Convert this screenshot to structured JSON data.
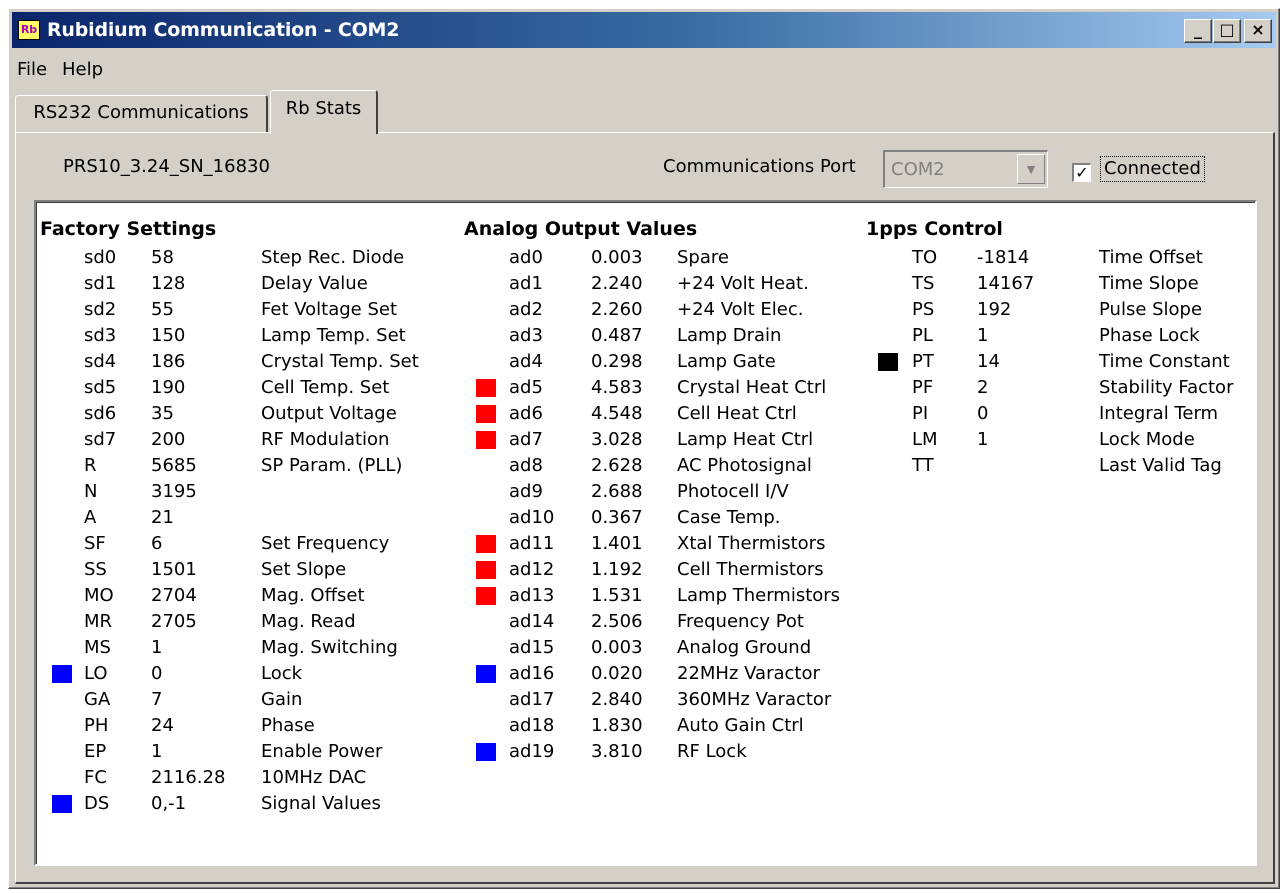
{
  "window": {
    "title": "Rubidium Communication - COM2",
    "icon_text": "Rb",
    "min_glyph": "_",
    "max_glyph": "□",
    "close_glyph": "×"
  },
  "menu": {
    "items": [
      "File",
      "Help"
    ]
  },
  "tabs": [
    {
      "label": "RS232 Communications",
      "active": false
    },
    {
      "label": "Rb Stats",
      "active": true
    }
  ],
  "header": {
    "firmware": "PRS10_3.24_SN_16830",
    "port_label": "Communications Port",
    "port_value": "COM2",
    "connected_label": "Connected",
    "connected_checked": true
  },
  "colors": {
    "red": "#ff0000",
    "blue": "#0000ff",
    "black": "#000000"
  },
  "factory": {
    "title": "Factory Settings",
    "rows": [
      {
        "key": "sd0",
        "value": "58",
        "desc": "Step Rec. Diode",
        "indicator": null
      },
      {
        "key": "sd1",
        "value": "128",
        "desc": "Delay Value",
        "indicator": null
      },
      {
        "key": "sd2",
        "value": "55",
        "desc": "Fet Voltage Set",
        "indicator": null
      },
      {
        "key": "sd3",
        "value": "150",
        "desc": "Lamp Temp. Set",
        "indicator": null
      },
      {
        "key": "sd4",
        "value": "186",
        "desc": "Crystal Temp. Set",
        "indicator": null
      },
      {
        "key": "sd5",
        "value": "190",
        "desc": "Cell Temp. Set",
        "indicator": null
      },
      {
        "key": "sd6",
        "value": "35",
        "desc": "Output Voltage",
        "indicator": null
      },
      {
        "key": "sd7",
        "value": "200",
        "desc": "RF Modulation",
        "indicator": null
      },
      {
        "key": "R",
        "value": "5685",
        "desc": "SP Param. (PLL)",
        "indicator": null
      },
      {
        "key": "N",
        "value": "3195",
        "desc": "",
        "indicator": null
      },
      {
        "key": "A",
        "value": "21",
        "desc": "",
        "indicator": null
      },
      {
        "key": "SF",
        "value": "6",
        "desc": "Set Frequency",
        "indicator": null
      },
      {
        "key": "SS",
        "value": "1501",
        "desc": "Set Slope",
        "indicator": null
      },
      {
        "key": "MO",
        "value": "2704",
        "desc": "Mag. Offset",
        "indicator": null
      },
      {
        "key": "MR",
        "value": "2705",
        "desc": "Mag. Read",
        "indicator": null
      },
      {
        "key": "MS",
        "value": "1",
        "desc": "Mag. Switching",
        "indicator": null
      },
      {
        "key": "LO",
        "value": "0",
        "desc": "Lock",
        "indicator": "blue"
      },
      {
        "key": "GA",
        "value": "7",
        "desc": "Gain",
        "indicator": null
      },
      {
        "key": "PH",
        "value": "24",
        "desc": "Phase",
        "indicator": null
      },
      {
        "key": "EP",
        "value": "1",
        "desc": "Enable Power",
        "indicator": null
      },
      {
        "key": "FC",
        "value": "2116.28",
        "desc": "10MHz DAC",
        "indicator": null
      },
      {
        "key": "DS",
        "value": "0,-1",
        "desc": "Signal Values",
        "indicator": "blue"
      }
    ]
  },
  "analog": {
    "title": "Analog Output Values",
    "rows": [
      {
        "key": "ad0",
        "value": "0.003",
        "desc": "Spare",
        "indicator": null
      },
      {
        "key": "ad1",
        "value": "2.240",
        "desc": "+24 Volt Heat.",
        "indicator": null
      },
      {
        "key": "ad2",
        "value": "2.260",
        "desc": "+24 Volt Elec.",
        "indicator": null
      },
      {
        "key": "ad3",
        "value": "0.487",
        "desc": "Lamp Drain",
        "indicator": null
      },
      {
        "key": "ad4",
        "value": "0.298",
        "desc": "Lamp Gate",
        "indicator": null
      },
      {
        "key": "ad5",
        "value": "4.583",
        "desc": "Crystal Heat Ctrl",
        "indicator": "red"
      },
      {
        "key": "ad6",
        "value": "4.548",
        "desc": "Cell Heat Ctrl",
        "indicator": "red"
      },
      {
        "key": "ad7",
        "value": "3.028",
        "desc": "Lamp Heat Ctrl",
        "indicator": "red"
      },
      {
        "key": "ad8",
        "value": "2.628",
        "desc": "AC Photosignal",
        "indicator": null
      },
      {
        "key": "ad9",
        "value": "2.688",
        "desc": "Photocell I/V",
        "indicator": null
      },
      {
        "key": "ad10",
        "value": "0.367",
        "desc": "Case Temp.",
        "indicator": null
      },
      {
        "key": "ad11",
        "value": "1.401",
        "desc": "Xtal Thermistors",
        "indicator": "red"
      },
      {
        "key": "ad12",
        "value": "1.192",
        "desc": "Cell Thermistors",
        "indicator": "red"
      },
      {
        "key": "ad13",
        "value": "1.531",
        "desc": "Lamp Thermistors",
        "indicator": "red"
      },
      {
        "key": "ad14",
        "value": "2.506",
        "desc": "Frequency Pot",
        "indicator": null
      },
      {
        "key": "ad15",
        "value": "0.003",
        "desc": "Analog Ground",
        "indicator": null
      },
      {
        "key": "ad16",
        "value": "0.020",
        "desc": "22MHz Varactor",
        "indicator": "blue"
      },
      {
        "key": "ad17",
        "value": "2.840",
        "desc": "360MHz Varactor",
        "indicator": null
      },
      {
        "key": "ad18",
        "value": "1.830",
        "desc": "Auto Gain Ctrl",
        "indicator": null
      },
      {
        "key": "ad19",
        "value": "3.810",
        "desc": "RF Lock",
        "indicator": "blue"
      }
    ]
  },
  "pps": {
    "title": "1pps Control",
    "rows": [
      {
        "key": "TO",
        "value": "-1814",
        "desc": "Time Offset",
        "indicator": null
      },
      {
        "key": "TS",
        "value": "14167",
        "desc": "Time Slope",
        "indicator": null
      },
      {
        "key": "PS",
        "value": "192",
        "desc": "Pulse Slope",
        "indicator": null
      },
      {
        "key": "PL",
        "value": "1",
        "desc": "Phase Lock",
        "indicator": null
      },
      {
        "key": "PT",
        "value": "14",
        "desc": "Time Constant",
        "indicator": "black"
      },
      {
        "key": "PF",
        "value": "2",
        "desc": "Stability Factor",
        "indicator": null
      },
      {
        "key": "PI",
        "value": "0",
        "desc": "Integral Term",
        "indicator": null
      },
      {
        "key": "LM",
        "value": "1",
        "desc": "Lock Mode",
        "indicator": null
      },
      {
        "key": "TT",
        "value": "",
        "desc": "Last Valid Tag",
        "indicator": null
      }
    ]
  }
}
